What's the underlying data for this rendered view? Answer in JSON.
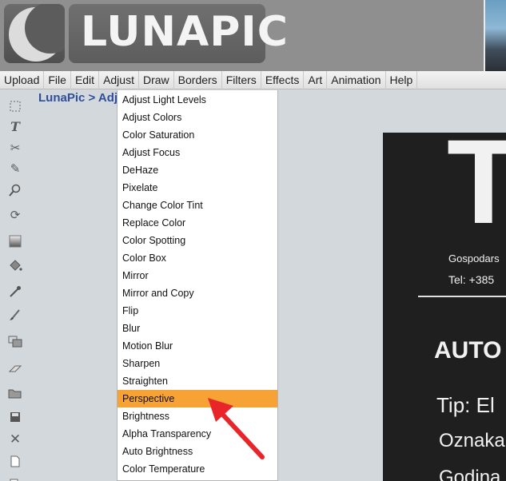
{
  "header": {
    "logo_text": "LUNAPIC"
  },
  "menu": {
    "items": [
      "Upload",
      "File",
      "Edit",
      "Adjust",
      "Draw",
      "Borders",
      "Filters",
      "Effects",
      "Art",
      "Animation",
      "Help"
    ]
  },
  "breadcrumb": {
    "text": "LunaPic > Adju"
  },
  "toolbar": {
    "icons": [
      "select-icon",
      "text-icon",
      "scissors-icon",
      "pencil-icon",
      "zoom-icon",
      "rotate-icon",
      "gradient-icon",
      "paint-bucket-icon",
      "eyedropper-icon",
      "brush-icon",
      "crop-icon",
      "eraser-icon",
      "open-icon",
      "save-icon",
      "close-icon",
      "new-file-icon",
      "copy-icon"
    ]
  },
  "dropdown": {
    "items": [
      "Adjust Light Levels",
      "Adjust Colors",
      "Color Saturation",
      "Adjust Focus",
      "DeHaze",
      "Pixelate",
      "Change Color Tint",
      "Replace Color",
      "Color Spotting",
      "Color Box",
      "Mirror",
      "Mirror and Copy",
      "Flip",
      "Blur",
      "Motion Blur",
      "Sharpen",
      "Straighten",
      "Perspective",
      "Brightness",
      "Alpha Transparency",
      "Auto Brightness",
      "Color Temperature"
    ],
    "highlighted": "Perspective"
  },
  "preview": {
    "big_letter": "T",
    "line1": "Gospodars",
    "line2": "Tel:  +385",
    "line3": "AUTO",
    "line4": "Tip:  El",
    "line5": "Oznaka",
    "line6": "Godina"
  },
  "colors": {
    "highlight": "#f6a234",
    "breadcrumb": "#2f4f9a",
    "arrow": "#e8262a"
  }
}
